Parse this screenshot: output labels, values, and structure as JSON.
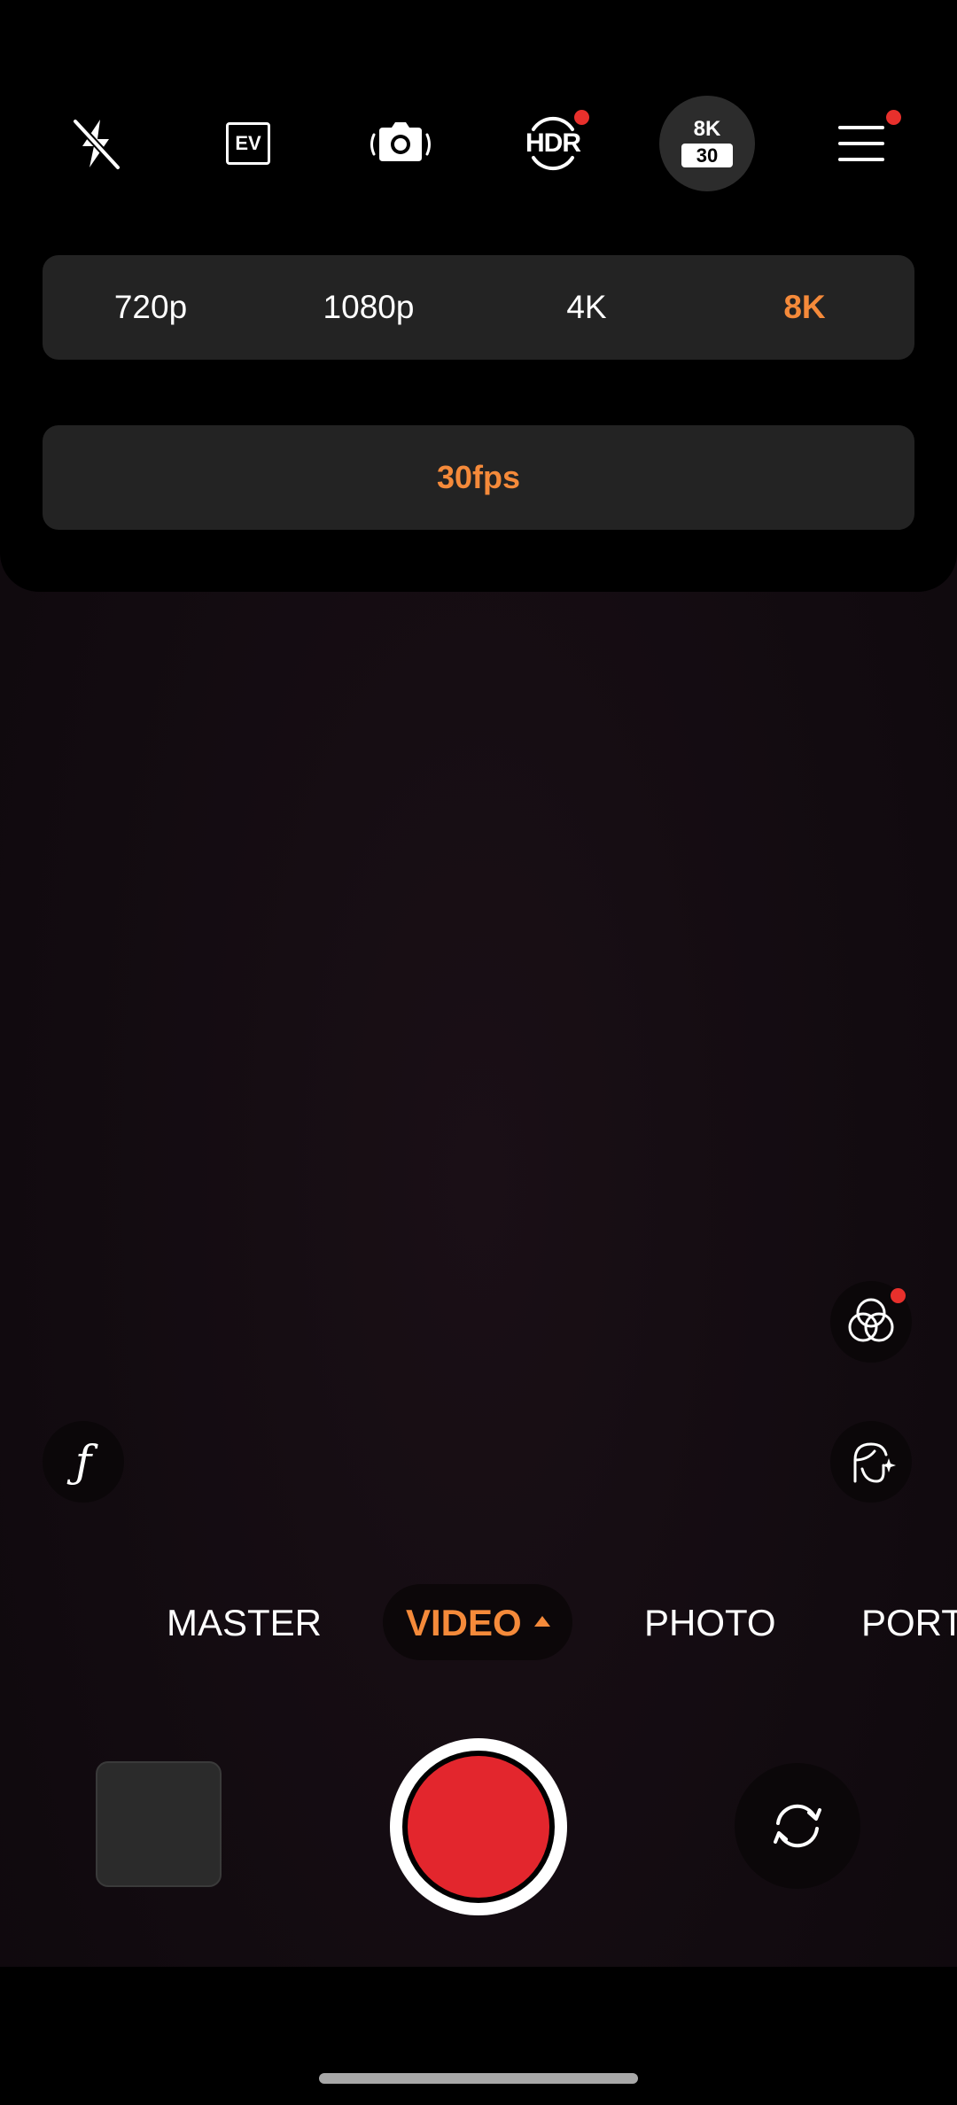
{
  "top_bar": {
    "icons": [
      "flash-off-icon",
      "ev-icon",
      "stabilization-icon",
      "hdr-icon",
      "resolution-badge",
      "menu-icon"
    ],
    "ev_label": "EV",
    "hdr_label": "HDR",
    "badge_resolution": "8K",
    "badge_fps": "30"
  },
  "resolution": {
    "options": [
      "720p",
      "1080p",
      "4K",
      "8K"
    ],
    "selected": "8K"
  },
  "fps": {
    "label": "30fps"
  },
  "modes": {
    "items": [
      "MASTER",
      "VIDEO",
      "PHOTO",
      "PORT"
    ],
    "selected": "VIDEO"
  },
  "colors": {
    "accent": "#f58a3a",
    "record_red": "#e3262d",
    "notification_dot": "#e8302c",
    "panel_bg": "#232323"
  }
}
